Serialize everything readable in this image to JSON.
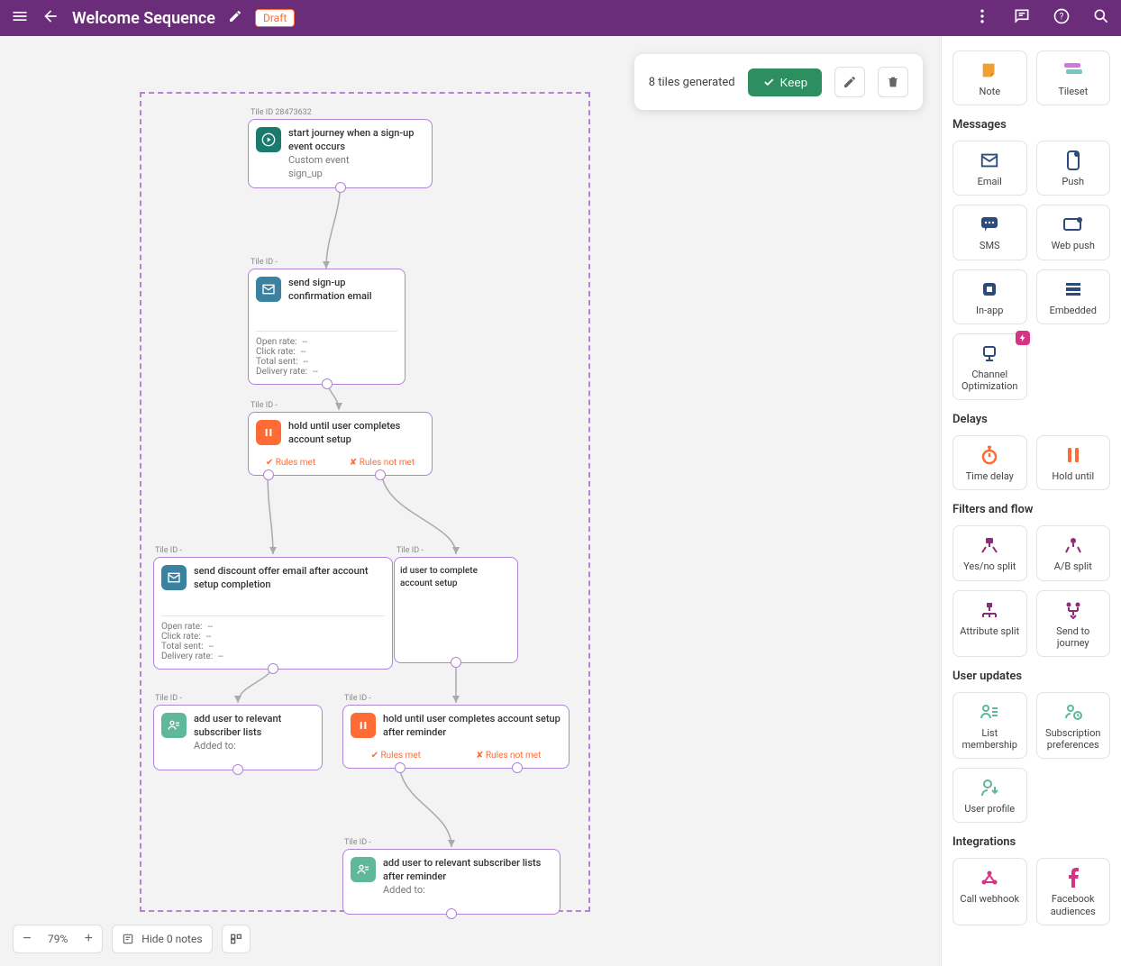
{
  "header": {
    "title": "Welcome Sequence",
    "status_badge": "Draft"
  },
  "notification": {
    "text": "8 tiles generated",
    "keep_label": "Keep"
  },
  "canvas": {
    "zoom": "79%",
    "notes_label": "Hide 0 notes"
  },
  "tiles": {
    "start": {
      "tile_id_label": "Tile ID 28473632",
      "title": "start journey when a sign-up event occurs",
      "line2": "Custom event",
      "line3": "sign_up"
    },
    "confirm_email": {
      "tile_id_label": "Tile ID -",
      "title": "send sign-up confirmation email",
      "stats": {
        "open_rate_label": "Open rate:",
        "open_rate_val": "--",
        "click_rate_label": "Click rate:",
        "click_rate_val": "--",
        "total_sent_label": "Total sent:",
        "total_sent_val": "--",
        "delivery_rate_label": "Delivery rate:",
        "delivery_rate_val": "--"
      }
    },
    "hold1": {
      "tile_id_label": "Tile ID -",
      "title": "hold until user completes account setup",
      "rules_met": "✔ Rules met",
      "rules_notmet": "✘ Rules not met"
    },
    "discount_email": {
      "tile_id_label": "Tile ID -",
      "title": "send discount offer email after account setup completion",
      "stats": {
        "open_rate_label": "Open rate:",
        "open_rate_val": "--",
        "click_rate_label": "Click rate:",
        "click_rate_val": "--",
        "total_sent_label": "Total sent:",
        "total_sent_val": "--",
        "delivery_rate_label": "Delivery rate:",
        "delivery_rate_val": "--"
      }
    },
    "remind_user": {
      "tile_id_label": "Tile ID -",
      "title": "id user to complete account setup"
    },
    "add_user1": {
      "tile_id_label": "Tile ID -",
      "title": "add user to relevant subscriber lists",
      "sub": "Added to:"
    },
    "hold2": {
      "tile_id_label": "Tile ID -",
      "title": "hold until user completes account setup after reminder",
      "rules_met": "✔ Rules met",
      "rules_notmet": "✘ Rules not met"
    },
    "add_user2": {
      "tile_id_label": "Tile ID -",
      "title": "add user to relevant subscriber lists after reminder",
      "sub": "Added to:"
    }
  },
  "sidebar": {
    "top": {
      "note": "Note",
      "tileset": "Tileset"
    },
    "messages_label": "Messages",
    "messages": {
      "email": "Email",
      "push": "Push",
      "sms": "SMS",
      "webpush": "Web push",
      "inapp": "In-app",
      "embedded": "Embedded",
      "channel": "Channel Optimization"
    },
    "delays_label": "Delays",
    "delays": {
      "timedelay": "Time delay",
      "holduntil": "Hold until"
    },
    "filters_label": "Filters and flow",
    "filters": {
      "yesno": "Yes/no split",
      "ab": "A/B split",
      "attr": "Attribute split",
      "send": "Send to journey"
    },
    "updates_label": "User updates",
    "updates": {
      "list": "List membership",
      "subs": "Subscription preferences",
      "profile": "User profile"
    },
    "integrations_label": "Integrations",
    "integrations": {
      "webhook": "Call webhook",
      "fb": "Facebook audiences"
    }
  }
}
